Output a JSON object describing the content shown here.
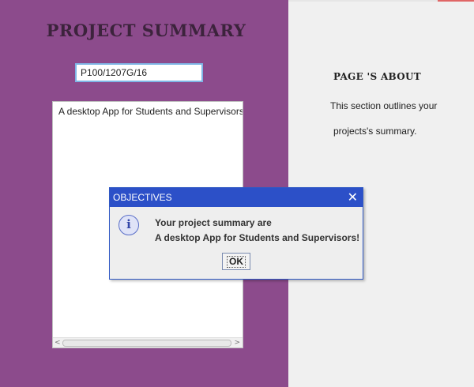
{
  "left": {
    "title": "PROJECT SUMMARY",
    "project_id": "P100/1207G/16",
    "summary_text": "A desktop App for Students and Supervisors",
    "scroll_left": "<",
    "scroll_right": ">"
  },
  "about": {
    "title": "PAGE 'S ABOUT",
    "line1": "This section outlines your",
    "line2": "projects's summary."
  },
  "dialog": {
    "title": "OBJECTIVES",
    "close": "✕",
    "icon": "i",
    "message_line1": "Your project summary are",
    "message_line2": "A desktop App for Students and Supervisors!",
    "ok_label": "OK"
  },
  "colors": {
    "left_panel": "#8c4b8c",
    "dialog_titlebar": "#2c50c8",
    "right_panel": "#f0f0f0"
  }
}
